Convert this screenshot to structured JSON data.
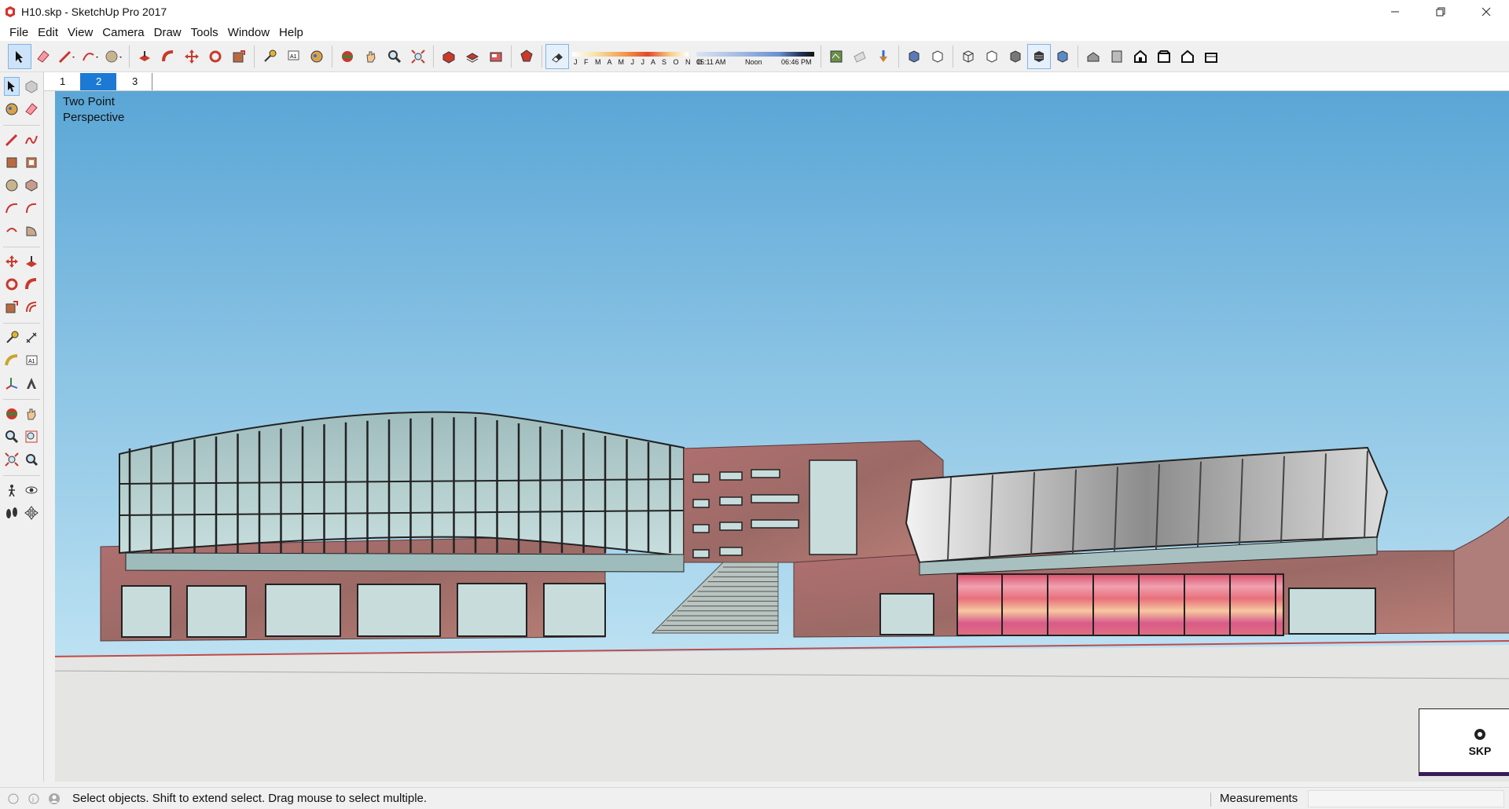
{
  "window": {
    "title": "H10.skp - SketchUp Pro 2017"
  },
  "menu": [
    "File",
    "Edit",
    "View",
    "Camera",
    "Draw",
    "Tools",
    "Window",
    "Help"
  ],
  "shadow_settings": {
    "months": "J F M A M J J A S O N D",
    "time_start": "05:11 AM",
    "time_mid": "Noon",
    "time_end": "06:46 PM"
  },
  "scenes": [
    {
      "label": "1",
      "active": false
    },
    {
      "label": "2",
      "active": true
    },
    {
      "label": "3",
      "active": false
    }
  ],
  "viewport": {
    "camera_label_line1": "Two Point",
    "camera_label_line2": "Perspective",
    "sky_top": "#5aa6d6",
    "sky_bottom": "#bfe3f3",
    "logo_text": "SKP"
  },
  "status": {
    "message": "Select objects. Shift to extend select. Drag mouse to select multiple.",
    "measurements_label": "Measurements",
    "measurements_value": ""
  },
  "icons": {
    "main_toolbar": [
      "select-icon",
      "eraser-icon",
      "line-icon",
      "arc-icon",
      "shapes-icon",
      "push-pull-icon",
      "follow-me-icon",
      "move-icon",
      "rotate-icon",
      "scale-icon",
      "tape-measure-icon",
      "text-icon",
      "paint-bucket-icon",
      "orbit-icon",
      "pan-icon",
      "zoom-icon",
      "zoom-extents-icon",
      "3d-warehouse-icon",
      "extension-warehouse-icon",
      "layout-icon",
      "extension-manager-icon",
      "shadows-toggle-icon",
      "geo-location-icon",
      "photo-textures-icon",
      "add-location-icon",
      "xray-icon",
      "back-edges-icon",
      "wireframe-icon",
      "hidden-line-icon",
      "shaded-icon",
      "shaded-textures-icon",
      "monochrome-icon",
      "iso-view-icon",
      "top-view-icon",
      "front-view-icon",
      "right-view-icon",
      "back-view-icon",
      "left-view-icon"
    ]
  }
}
